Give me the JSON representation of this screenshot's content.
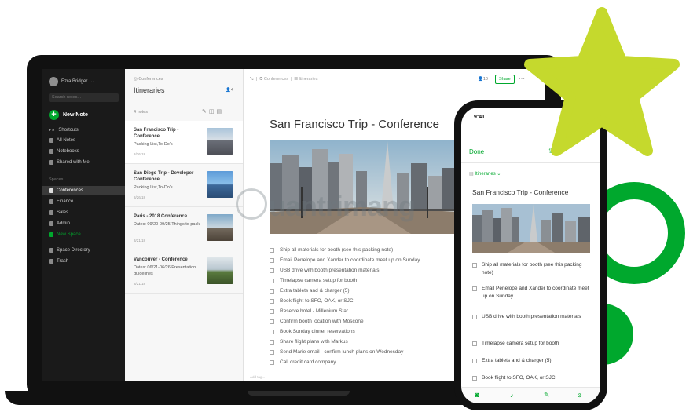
{
  "sidebar": {
    "user": "Ezra Bridger",
    "search_placeholder": "Search notes...",
    "new_note": "New Note",
    "items": [
      {
        "label": "Shortcuts",
        "icon": "star-icon"
      },
      {
        "label": "All Notes",
        "icon": "notes-icon"
      },
      {
        "label": "Notebooks",
        "icon": "notebook-icon"
      },
      {
        "label": "Shared with Me",
        "icon": "people-icon"
      }
    ],
    "spaces_header": "Spaces",
    "spaces": [
      {
        "label": "Conferences",
        "active": true
      },
      {
        "label": "Finance"
      },
      {
        "label": "Sales"
      },
      {
        "label": "Admin"
      },
      {
        "label": "New Space",
        "accent": true
      }
    ],
    "bottom_items": [
      {
        "label": "Space Directory",
        "icon": "directory-icon"
      },
      {
        "label": "Trash",
        "icon": "trash-icon"
      }
    ]
  },
  "notes_list": {
    "breadcrumb": "Conferences",
    "title": "Itineraries",
    "member_count": "4",
    "count_label": "4 notes",
    "notes": [
      {
        "title": "San Francisco Trip - Conference",
        "snippet": "Packing List,To-Do's",
        "date": "8/26/18",
        "selected": true
      },
      {
        "title": "San Diego Trip - Developer Conference",
        "snippet": "Packing List,To-Do's",
        "date": "8/26/18"
      },
      {
        "title": "Paris - 2018 Conference",
        "snippet": "Dates: 09/20-09/25 Things to pack",
        "date": "8/21/18"
      },
      {
        "title": "Vancouver - Conference",
        "snippet": "Dates: 06/21-06/26 Presentation guidelines",
        "date": "8/21/18"
      }
    ]
  },
  "editor": {
    "breadcrumb_space": "Conferences",
    "breadcrumb_notebook": "Itineraries",
    "member_count": "10",
    "share_label": "Share",
    "note_title": "San Francisco Trip - Conference",
    "checklist": [
      "Ship all materials for booth (see this packing note)",
      "Email Penelope and Xander to coordinate meet up on Sunday",
      "USB drive with booth presentation materials",
      "Timelapse camera setup for booth",
      "Extra tablets and & charger (5)",
      "Book flight to SFO, OAK, or SJC",
      "Reserve hotel - Millenium Star",
      "Confirm booth location with Moscone",
      "Book Sunday dinner reservations",
      "Share flight plans with Markus",
      "Send Marie email - confirm lunch plans on Wednesday",
      "Call credit card company"
    ],
    "footer": "Add tag..."
  },
  "phone": {
    "time": "9:41",
    "done_label": "Done",
    "notebook": "Itineraries",
    "note_title": "San Francisco Trip - Conference",
    "checklist": [
      "Ship all materials for booth (see this packing note)",
      "Email Penelope and Xander to coordinate meet up on Sunday",
      "USB drive with booth presentation materials",
      "Timelapse camera setup for booth",
      "Extra tablets and & charger (5)",
      "Book flight to SFO, OAK, or SJC"
    ]
  },
  "watermark": "uantrimang",
  "colors": {
    "accent": "#00a82d",
    "star": "#c5d92d",
    "sidebar_bg": "#1a1a1a"
  }
}
